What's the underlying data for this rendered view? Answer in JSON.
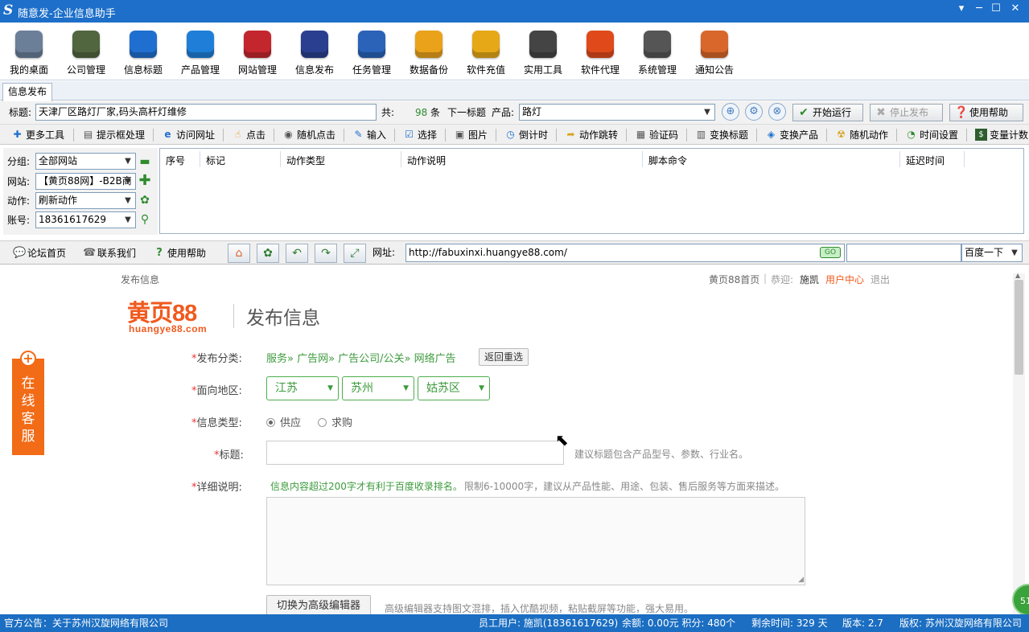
{
  "window": {
    "logo": "S",
    "title": "随意发-企业信息助手",
    "controls": [
      "▾",
      "─",
      "☐",
      "✕"
    ]
  },
  "ribbon": {
    "items": [
      {
        "label": "我的桌面",
        "icon": "house-icon",
        "color": "#6b7f99"
      },
      {
        "label": "公司管理",
        "icon": "company-icon",
        "color": "#51663f"
      },
      {
        "label": "信息标题",
        "icon": "info-icon",
        "color": "#1f6fd0"
      },
      {
        "label": "产品管理",
        "icon": "cloud-icon",
        "color": "#1f7fd8"
      },
      {
        "label": "网站管理",
        "icon": "website-icon",
        "color": "#c4262e"
      },
      {
        "label": "信息发布",
        "icon": "magic-wand-icon",
        "color": "#2a3f8f"
      },
      {
        "label": "任务管理",
        "icon": "task-chart-icon",
        "color": "#2a63b8"
      },
      {
        "label": "数据备份",
        "icon": "backup-icon",
        "color": "#e9a21a"
      },
      {
        "label": "软件充值",
        "icon": "recharge-icon",
        "color": "#e6a817"
      },
      {
        "label": "实用工具",
        "icon": "tools-icon",
        "color": "#444444"
      },
      {
        "label": "软件代理",
        "icon": "gift-icon",
        "color": "#e04a1b"
      },
      {
        "label": "系统管理",
        "icon": "gear-icon",
        "color": "#555555"
      },
      {
        "label": "通知公告",
        "icon": "notice-icon",
        "color": "#d9672b"
      }
    ]
  },
  "tabs": {
    "active": "信息发布"
  },
  "publish": {
    "title_label": "标题:",
    "title_value": "天津厂区路灯厂家,码头高杆灯维修",
    "count_label": "共:",
    "count_value": "98",
    "count_unit": "条",
    "next_title": "下一标题",
    "product_label": "产品:",
    "product_value": "路灯",
    "circle_icons": [
      "⊕",
      "⚙",
      "⊗"
    ],
    "start_button": "开始运行",
    "stop_button": "停止发布",
    "help_button": "使用帮助"
  },
  "toolbar2": [
    {
      "label": "更多工具",
      "icon": "more-tools-icon",
      "glyph": "✚"
    },
    {
      "label": "提示框处理",
      "icon": "dialog-icon",
      "glyph": "▤"
    },
    {
      "label": "访问网址",
      "icon": "browser-icon",
      "glyph": "e"
    },
    {
      "label": "点击",
      "icon": "hand-pointer-icon",
      "glyph": "☝"
    },
    {
      "label": "随机点击",
      "icon": "random-click-icon",
      "glyph": "◉"
    },
    {
      "label": "输入",
      "icon": "pencil-icon",
      "glyph": "✎"
    },
    {
      "label": "选择",
      "icon": "checkbox-icon",
      "glyph": "☑"
    },
    {
      "label": "图片",
      "icon": "image-icon",
      "glyph": "▣"
    },
    {
      "label": "倒计时",
      "icon": "clock-icon",
      "glyph": "◷"
    },
    {
      "label": "动作跳转",
      "icon": "folder-jump-icon",
      "glyph": "➦"
    },
    {
      "label": "验证码",
      "icon": "captcha-icon",
      "glyph": "▦"
    },
    {
      "label": "变换标题",
      "icon": "swap-title-icon",
      "glyph": "▥"
    },
    {
      "label": "变换产品",
      "icon": "swap-product-icon",
      "glyph": "◈"
    },
    {
      "label": "随机动作",
      "icon": "radiation-icon",
      "glyph": "☢"
    },
    {
      "label": "时间设置",
      "icon": "time-settings-icon",
      "glyph": "◔"
    },
    {
      "label": "变量计数",
      "icon": "counter-icon",
      "glyph": "$"
    }
  ],
  "sidebar": {
    "group_label": "分组:",
    "group_value": "全部网站",
    "site_label": "网站:",
    "site_value": "【黄页88网】-B2B商",
    "action_label": "动作:",
    "action_value": "刷新动作",
    "account_label": "账号:",
    "account_value": "18361617629"
  },
  "grid": {
    "columns": [
      "序号",
      "标记",
      "动作类型",
      "动作说明",
      "脚本命令",
      "延迟时间"
    ]
  },
  "nav": {
    "forum": "论坛首页",
    "contact": "联系我们",
    "help": "使用帮助",
    "url_label": "网址:",
    "url_value": "http://fabuxinxi.huangye88.com/",
    "search_engine": "百度一下"
  },
  "web": {
    "top_left": "发布信息",
    "top_links": [
      "黄页88首页",
      "|",
      "恭迎:",
      "施凯",
      "用户中心",
      "退出"
    ],
    "logo_main": "黄页88",
    "logo_sub": "huangye88.com",
    "page_title": "发布信息",
    "category_label": "发布分类:",
    "category_path": "服务» 广告网» 广告公司/公关» 网络广告",
    "reselect": "返回重选",
    "region_label": "面向地区:",
    "regions": [
      "江苏",
      "苏州",
      "姑苏区"
    ],
    "type_label": "信息类型:",
    "type_supply": "供应",
    "type_demand": "求购",
    "title_label": "标题:",
    "title_hint": "建议标题包含产品型号、参数、行业名。",
    "detail_label": "详细说明:",
    "detail_hint_green": "信息内容超过200字才有利于百度收录排名。",
    "detail_hint_gray": "限制6-10000字，建议从产品性能、用途、包装、售后服务等方面来描述。",
    "switch_editor": "切换为高级编辑器",
    "editor_hint": "高级编辑器支持图文混排，插入优酷视频，粘贴截屏等功能，强大易用。",
    "kefu": [
      "在",
      "线",
      "客",
      "服"
    ]
  },
  "badge": "51",
  "status": {
    "notice": "官方公告：关于苏州汉旋网络有限公司",
    "user": "员工用户: 施凯(18361617629)",
    "balance": "余额: 0.00元 积分: 480个",
    "remaining": "剩余时间: 329 天",
    "version": "版本: 2.7",
    "copyright": "版权: 苏州汉旋网络有限公司"
  }
}
